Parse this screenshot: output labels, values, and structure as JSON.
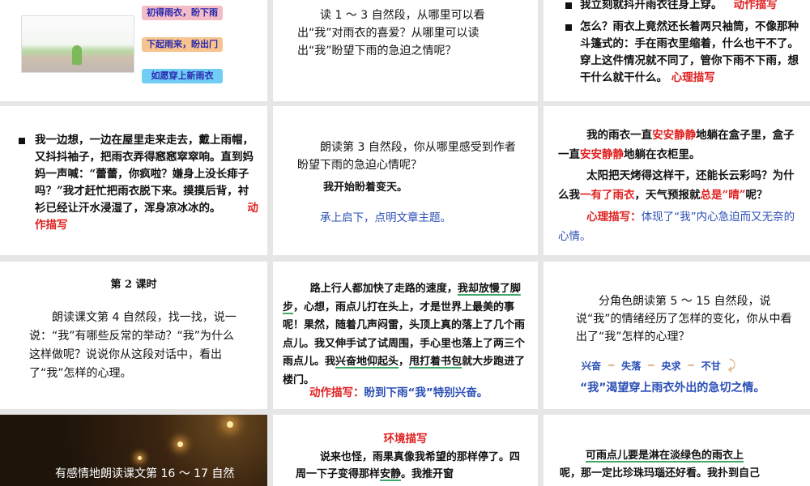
{
  "slide1": {
    "tags": [
      "初得雨衣，盼下雨",
      "下起雨来，盼出门",
      "如愿穿上新雨衣"
    ],
    "tag_colors": [
      "#f4bcc6",
      "#f8c48e",
      "#6fcdf6"
    ]
  },
  "slide2": {
    "text": "读 1 ～ 3 自然段，从哪里可以看出“我”对雨衣的喜爱？从哪里可以读出“我”盼望下雨的急迫之情呢？"
  },
  "slide3": {
    "item1": "我立刻就抖开雨衣往身上穿。",
    "item1_label": "动作描写",
    "item2": "怎么？雨衣上竟然还长着两只袖筒，不像那种斗篷式的：手在雨衣里缩着，什么也干不了。穿上这件情况就不同了，管你下雨不下雨，想干什么就干什么。",
    "item2_label": "心理描写"
  },
  "slide4": {
    "text": "我一边想，一边在屋里走来走去，戴上雨帽，又抖抖袖子，把雨衣弄得窸窸窣窣响。直到妈妈一声喊：“蕾蕾，你疯啦？嫌身上没长痱子吗？”我才赶忙把雨衣脱下来。摸摸后背，衬衫已经让汗水浸湿了，浑身凉冰冰的。",
    "label": "动作描写"
  },
  "slide5": {
    "question": "朗读第 3 自然段，你从哪里感受到作者盼望下雨的急迫心情呢？",
    "quote": "我开始盼着变天。",
    "answer": "承上启下，点明文章主题。"
  },
  "slide6": {
    "p1": [
      "我的雨衣一直",
      "安安静静",
      "地躺在盒子里，盒子一直",
      "安安静静",
      "地躺在衣柜里。"
    ],
    "p2": [
      "太阳把天烤得这样干，还能长云彩吗？为什么我",
      "一有了雨衣",
      "，天气预报就",
      "总是“晴”",
      "呢？"
    ],
    "label": "心理描写：",
    "note": "体现了“我”内心急迫而又无奈的心情。"
  },
  "slide7": {
    "title": "第 2 课时",
    "text": "朗读课文第 4 自然段，找一找，说一说：“我”有哪些反常的举动？“我”为什么这样做呢？说说你从这段对话中，看出了“我”怎样的心理。"
  },
  "slide8": {
    "parts": [
      "路上行人都加快了走路的速度，",
      "我却放慢了脚步",
      "，心想，雨点儿打在头上，才是世界上最美的事呢！果然，随着几声闷雷，头顶上真的落上了几个雨点儿。我又伸手试了试周围，手心里也落上了两三个雨点儿。我",
      "兴奋地仰起头",
      "，",
      "甩打着书包",
      "就大步跑进了楼门。"
    ],
    "label": "动作描写：",
    "note": "盼到下雨“我”特别兴奋。"
  },
  "slide9": {
    "question": "分角色朗读第 5 ～ 15 自然段，说说“我”的情绪经历了怎样的变化，你从中看出了“我”怎样的心理？",
    "flow": [
      "兴奋",
      "失落",
      "央求",
      "不甘"
    ],
    "conclusion": "“我”渴望穿上雨衣外出的急切之情。"
  },
  "slide10": {
    "text": "有感情地朗读课文第 16 ～ 17 自然"
  },
  "slide11": {
    "title": "环境描写",
    "parts": [
      "说来也怪，雨果真像我希望的那样停了。四周一下子变得那样",
      "安静",
      "。我推开窗"
    ]
  },
  "slide12": {
    "line1": "可雨点儿要是淋在淡绿色的雨衣上",
    "line2": "呢，那一定比珍珠玛瑙还好看。我扑到自己"
  }
}
